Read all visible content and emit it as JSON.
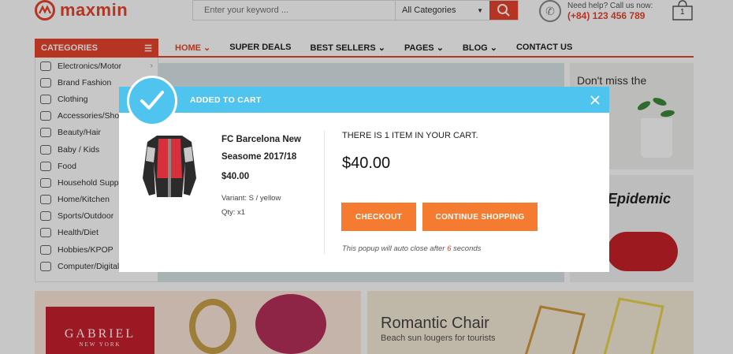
{
  "header": {
    "logo_text": "maxmin",
    "search_placeholder": "Enter your keyword ...",
    "search_category": "All Categories",
    "help_text": "Need help? Call us now:",
    "phone": "(+84) 123 456 789",
    "cart_count": "1"
  },
  "categories_label": "CATEGORIES",
  "nav": [
    "HOME",
    "SUPER DEALS",
    "BEST SELLERS",
    "PAGES",
    "BLOG",
    "CONTACT US"
  ],
  "sidebar": {
    "items": [
      {
        "label": "Electronics/Motor",
        "arrow": "›"
      },
      {
        "label": "Brand Fashion",
        "arrow": "›"
      },
      {
        "label": "Clothing",
        "arrow": ""
      },
      {
        "label": "Accessories/Shoes",
        "arrow": ""
      },
      {
        "label": "Beauty/Hair",
        "arrow": ""
      },
      {
        "label": "Baby / Kids",
        "arrow": ""
      },
      {
        "label": "Food",
        "arrow": ""
      },
      {
        "label": "Household Supplies",
        "arrow": ""
      },
      {
        "label": "Home/Kitchen",
        "arrow": ""
      },
      {
        "label": "Sports/Outdoor",
        "arrow": ""
      },
      {
        "label": "Health/Diet",
        "arrow": ""
      },
      {
        "label": "Hobbies/KPOP",
        "arrow": ""
      },
      {
        "label": "Computer/Digital",
        "arrow": ""
      }
    ]
  },
  "banners": {
    "right_top": "Don't miss the",
    "right_mid": "Epidemic",
    "gabriel_title": "GABRIEL",
    "gabriel_sub": "NEW YORK",
    "chair_title": "Romantic Chair",
    "chair_sub": "Beach sun lougers for tourists"
  },
  "modal": {
    "title": "ADDED TO CART",
    "product_name": "FC Barcelona New Seasome 2017/18",
    "price": "$40.00",
    "variant": "Variant: S / yellow",
    "qty": "Qty: x1",
    "cart_message": "THERE IS 1 ITEM IN YOUR CART.",
    "total": "$40.00",
    "checkout_label": "CHECKOUT",
    "continue_label": "CONTINUE SHOPPING",
    "autoclose_prefix": "This popup will auto close after ",
    "autoclose_seconds": "6",
    "autoclose_suffix": " seconds"
  },
  "colors": {
    "accent": "#e8452c",
    "modal_header": "#4ec4ef",
    "button": "#f47b2f"
  }
}
